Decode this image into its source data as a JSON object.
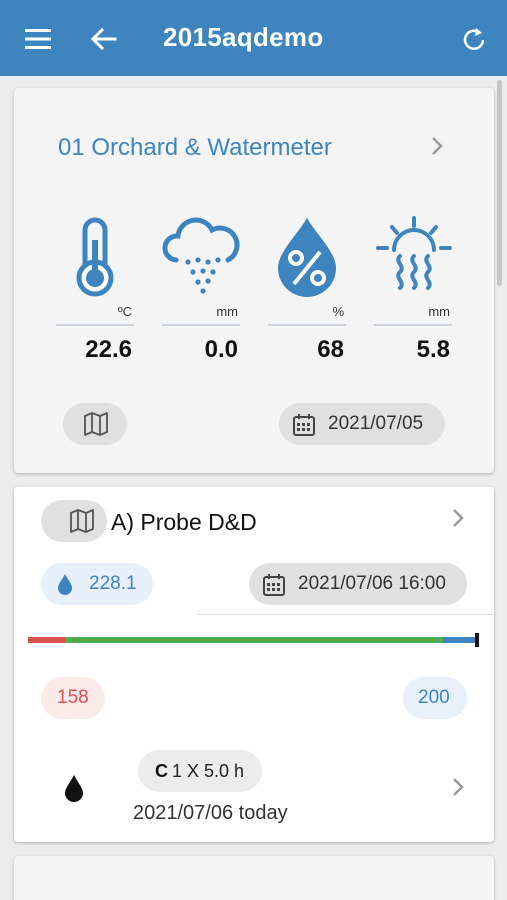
{
  "appbar": {
    "title": "2015aqdemo",
    "menu_icon": "menu-icon",
    "back_icon": "arrow-left-icon",
    "refresh_icon": "refresh-icon",
    "color": "#3e84bf"
  },
  "station": {
    "title": "01 Orchard & Watermeter",
    "metrics": [
      {
        "icon": "thermometer-icon",
        "unit": "ºC",
        "value": "22.6"
      },
      {
        "icon": "rain-cloud-icon",
        "unit": "mm",
        "value": "0.0"
      },
      {
        "icon": "humidity-drop-icon",
        "unit": "%",
        "value": "68"
      },
      {
        "icon": "evaporation-sun-icon",
        "unit": "mm",
        "value": "5.8"
      }
    ],
    "map_icon": "map-icon",
    "date_icon": "calendar-icon",
    "date": "2021/07/05"
  },
  "probe": {
    "title": "A) Probe D&D",
    "water_icon": "water-drop-icon",
    "water_value": "228.1",
    "date_icon": "calendar-icon",
    "datetime": "2021/07/06 16:00",
    "bar_colors": {
      "low": "#d9534f",
      "ok": "#4cae4c",
      "high": "#3e84bf"
    },
    "low_bound": "158",
    "high_bound": "200",
    "irrigation": {
      "code": "C",
      "text": "1 X 5.0 h",
      "date": "2021/07/06 today",
      "icon": "drop-icon"
    }
  }
}
